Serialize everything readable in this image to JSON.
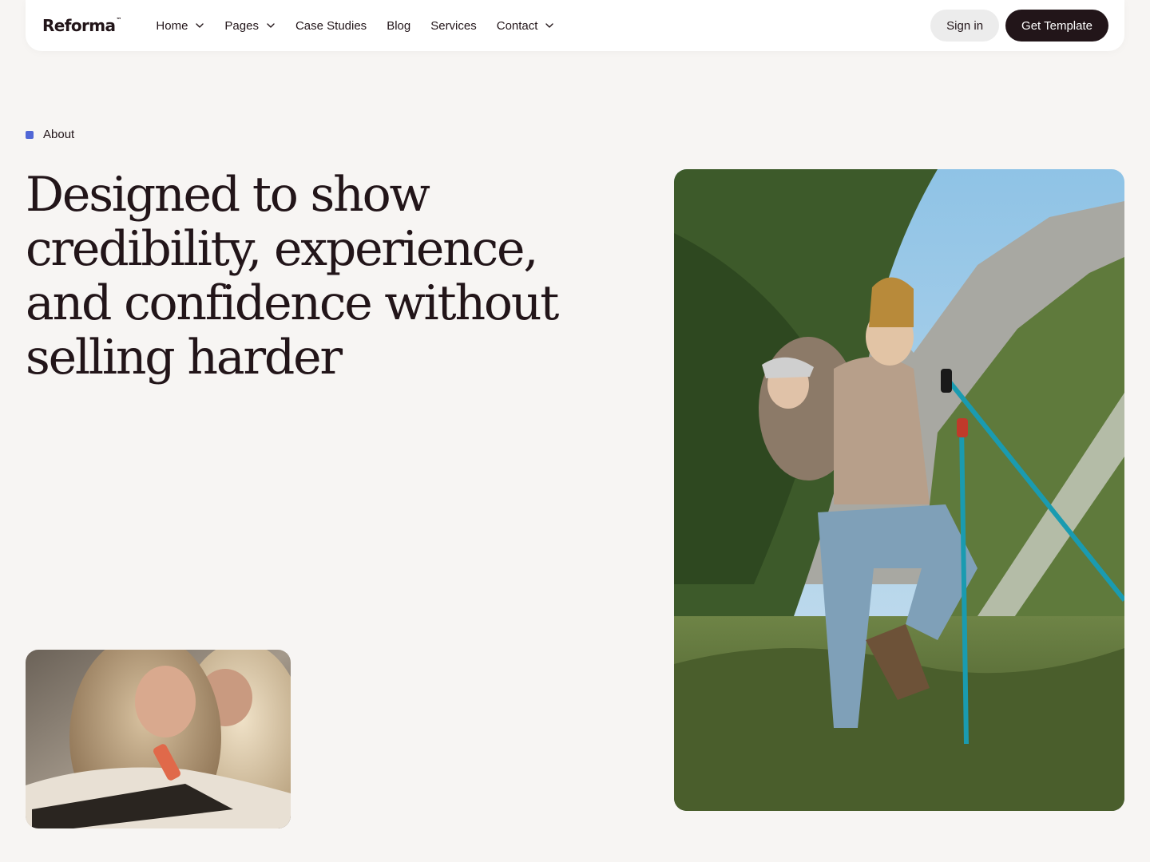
{
  "brand": {
    "name": "Reforma",
    "trademark": "™"
  },
  "nav": {
    "items": [
      {
        "label": "Home",
        "dropdown": true
      },
      {
        "label": "Pages",
        "dropdown": true
      },
      {
        "label": "Case Studies",
        "dropdown": false
      },
      {
        "label": "Blog",
        "dropdown": false
      },
      {
        "label": "Services",
        "dropdown": false
      },
      {
        "label": "Contact",
        "dropdown": true
      }
    ],
    "signin_label": "Sign in",
    "cta_label": "Get Template"
  },
  "hero": {
    "eyebrow": "About",
    "headline_lines": [
      "Designed to show",
      "credibility, experience,",
      "and confidence without",
      "selling harder"
    ]
  },
  "images": {
    "small": "mother-and-daughter-drawing-photo",
    "large": "hiker-with-baby-in-mountains-photo"
  },
  "colors": {
    "background": "#f7f5f3",
    "text": "#221519",
    "accent": "#5167d6",
    "cta_bg": "#221519",
    "signin_bg": "#ececec"
  }
}
